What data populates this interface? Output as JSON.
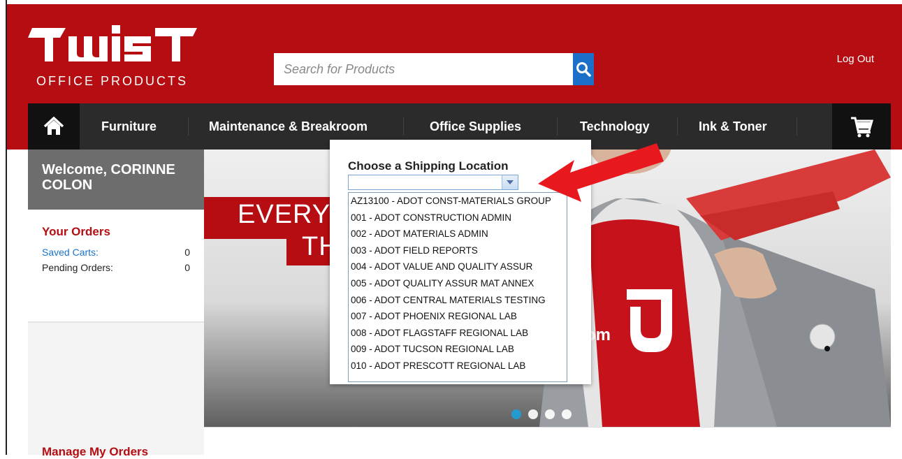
{
  "brand": {
    "logo_text": "WiST",
    "subtitle": "OFFICE PRODUCTS",
    "colors": {
      "primary": "#b50d12",
      "nav": "#2b2b2b",
      "accent": "#1c6fc9"
    }
  },
  "header": {
    "search_placeholder": "Search for Products",
    "search_icon": "search-icon",
    "logout_label": "Log Out"
  },
  "nav": {
    "home_icon": "home-icon",
    "items": [
      "Furniture",
      "Maintenance & Breakroom",
      "Office Supplies",
      "Technology",
      "Ink & Toner"
    ],
    "cart_icon": "cart-icon"
  },
  "sidebar": {
    "welcome": "Welcome, CORINNE COLON",
    "orders_title": "Your Orders",
    "saved_carts_label": "Saved Carts:",
    "saved_carts_count": "0",
    "pending_orders_label": "Pending Orders:",
    "pending_orders_count": "0",
    "manage_label": "Manage My Orders"
  },
  "banner": {
    "text_line1": "EVERYT",
    "text_line2": "TH",
    "logo_suffix": ".com",
    "slides_total": 4,
    "slide_active": 1
  },
  "popup": {
    "title": "Choose a Shipping Location",
    "selected_value": "",
    "options": [
      "AZ13100 - ADOT CONST-MATERIALS GROUP",
      "001 - ADOT CONSTRUCTION ADMIN",
      "002 - ADOT MATERIALS ADMIN",
      "003 - ADOT FIELD REPORTS",
      "004 - ADOT VALUE AND QUALITY ASSUR",
      "005 - ADOT QUALITY ASSUR MAT ANNEX",
      "006 - ADOT CENTRAL MATERIALS TESTING",
      "007 - ADOT PHOENIX REGIONAL LAB",
      "008 - ADOT FLAGSTAFF REGIONAL LAB",
      "009 - ADOT TUCSON REGIONAL LAB",
      "010 - ADOT PRESCOTT REGIONAL LAB"
    ]
  },
  "annotation": {
    "arrow_color": "#e8191e"
  }
}
